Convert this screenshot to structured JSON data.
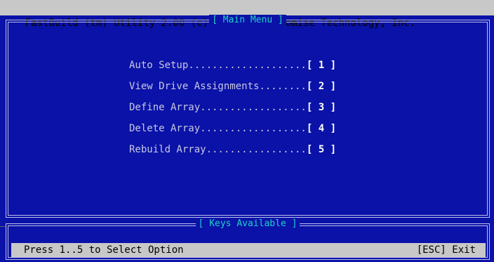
{
  "app": {
    "title": "FastBuild (tm) Utility 2.00 (c) 2002-2005 Promise Technology, Inc."
  },
  "main_menu": {
    "title": "[ Main Menu ]",
    "items": [
      {
        "label": "Auto Setup....................",
        "key": "[ 1 ]"
      },
      {
        "label": "View Drive Assignments........",
        "key": "[ 2 ]"
      },
      {
        "label": "Define Array..................",
        "key": "[ 3 ]"
      },
      {
        "label": "Delete Array..................",
        "key": "[ 4 ]"
      },
      {
        "label": "Rebuild Array.................",
        "key": "[ 5 ]"
      }
    ]
  },
  "keys_panel": {
    "title": "[ Keys Available ]",
    "hint": "Press 1..5 to Select Option",
    "exit_label": "[ESC] Exit"
  },
  "colors": {
    "background": "#0a12a8",
    "title_bar": "#c8c8c8",
    "frame_title": "#1fd1c9",
    "menu_text": "#c8c8e0"
  }
}
